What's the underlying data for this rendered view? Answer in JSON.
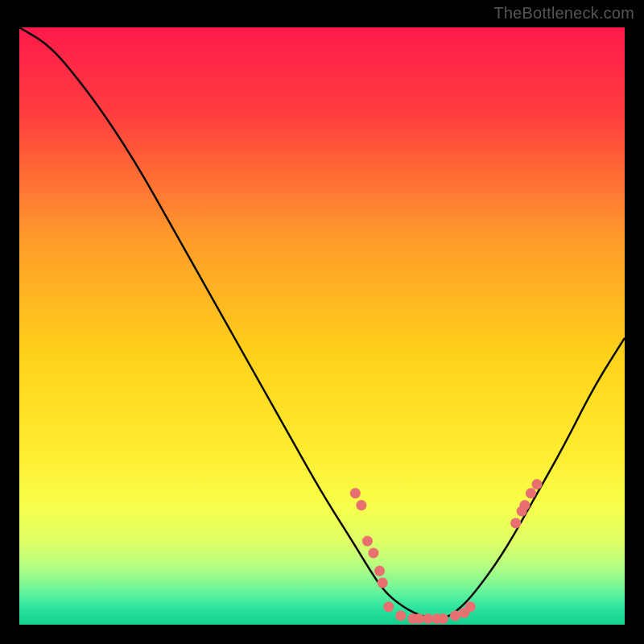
{
  "watermark": "TheBottleneck.com",
  "chart_data": {
    "type": "line",
    "title": "",
    "xlabel": "",
    "ylabel": "",
    "xlim": [
      0,
      100
    ],
    "ylim": [
      0,
      100
    ],
    "grid": false,
    "series": [
      {
        "name": "bottleneck-curve",
        "x": [
          0,
          5,
          10,
          15,
          20,
          25,
          30,
          35,
          40,
          45,
          50,
          55,
          58,
          60,
          62,
          65,
          68,
          70,
          72,
          75,
          80,
          85,
          90,
          95,
          100
        ],
        "y": [
          100,
          97,
          91,
          84,
          76,
          67,
          58,
          49,
          40,
          31,
          22,
          14,
          9,
          6,
          4,
          2,
          1,
          1,
          2,
          5,
          12,
          21,
          30,
          40,
          48
        ]
      }
    ],
    "points": [
      {
        "x": 55.5,
        "y": 22
      },
      {
        "x": 56.5,
        "y": 20
      },
      {
        "x": 57.5,
        "y": 14
      },
      {
        "x": 58.5,
        "y": 12
      },
      {
        "x": 59.5,
        "y": 9
      },
      {
        "x": 60,
        "y": 7
      },
      {
        "x": 61,
        "y": 3
      },
      {
        "x": 63,
        "y": 1.5
      },
      {
        "x": 65,
        "y": 1
      },
      {
        "x": 66,
        "y": 1
      },
      {
        "x": 67.5,
        "y": 1
      },
      {
        "x": 69,
        "y": 1
      },
      {
        "x": 70,
        "y": 1
      },
      {
        "x": 72,
        "y": 1.5
      },
      {
        "x": 73.5,
        "y": 2
      },
      {
        "x": 74.5,
        "y": 3
      },
      {
        "x": 82,
        "y": 17
      },
      {
        "x": 83,
        "y": 19
      },
      {
        "x": 83.5,
        "y": 20
      },
      {
        "x": 84.5,
        "y": 22
      },
      {
        "x": 85.5,
        "y": 23.5
      }
    ],
    "gradient_stops": [
      {
        "offset": 0,
        "color": "#ff1a4a"
      },
      {
        "offset": 0.15,
        "color": "#ff3f3f"
      },
      {
        "offset": 0.35,
        "color": "#ff9a2a"
      },
      {
        "offset": 0.55,
        "color": "#ffd21a"
      },
      {
        "offset": 0.72,
        "color": "#ffee33"
      },
      {
        "offset": 0.8,
        "color": "#f7ff4a"
      },
      {
        "offset": 0.86,
        "color": "#e0ff66"
      },
      {
        "offset": 0.9,
        "color": "#b8ff80"
      },
      {
        "offset": 0.94,
        "color": "#70f59a"
      },
      {
        "offset": 0.97,
        "color": "#30e6a0"
      },
      {
        "offset": 1.0,
        "color": "#15d090"
      }
    ],
    "point_color": "#e97070",
    "curve_color": "#0a0a0a"
  }
}
